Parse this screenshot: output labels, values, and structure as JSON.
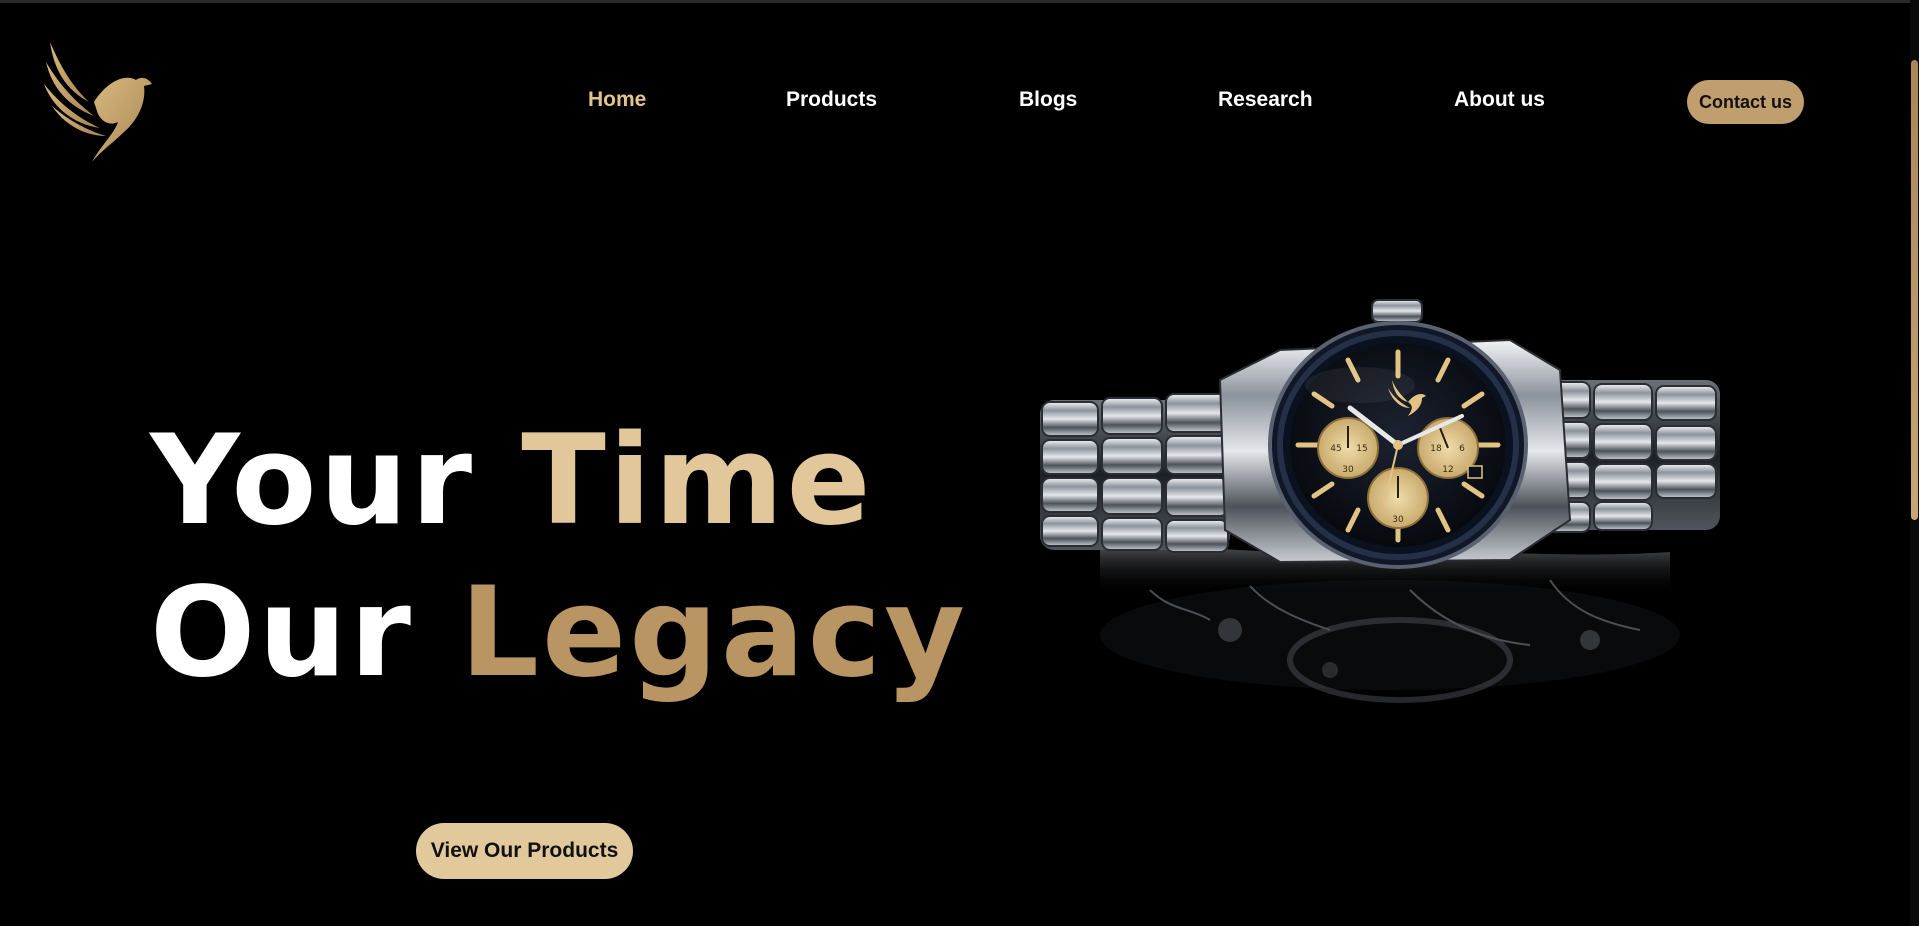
{
  "nav": {
    "items": [
      {
        "label": "Home",
        "active": true
      },
      {
        "label": "Products",
        "active": false
      },
      {
        "label": "Blogs",
        "active": false
      },
      {
        "label": "Research",
        "active": false
      },
      {
        "label": "About us",
        "active": false
      }
    ],
    "contact_label": "Contact us"
  },
  "hero": {
    "line1_white": "Your",
    "line1_gold": "Time",
    "line2_white": "Our",
    "line2_gold": "Legacy",
    "cta_label": "View Our Products"
  },
  "watch": {
    "subdial_values": [
      "45",
      "15",
      "30",
      "18",
      "6",
      "12",
      "30"
    ]
  },
  "colors": {
    "background": "#000000",
    "gold_light": "#e2c79a",
    "gold_dark": "#b89563",
    "button_gold": "#c09e6e"
  },
  "icons": {
    "logo": "phoenix-bird-logo-icon"
  }
}
